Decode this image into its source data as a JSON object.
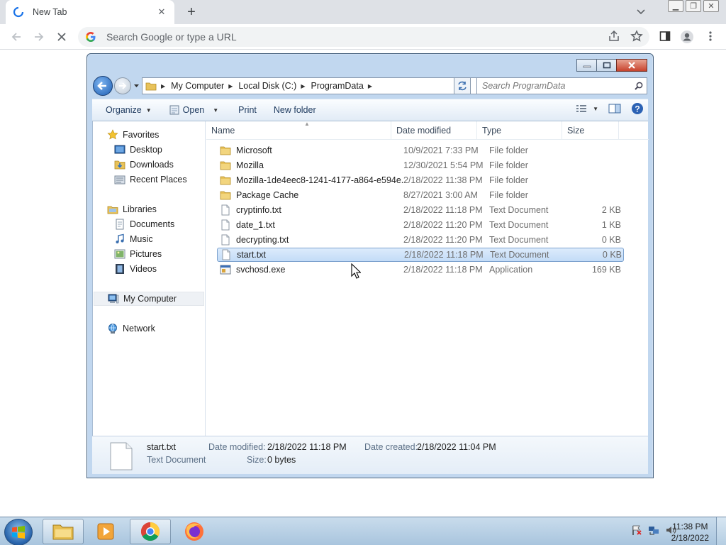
{
  "browser": {
    "tab_title": "New Tab",
    "omnibox_placeholder": "Search Google or type a URL"
  },
  "explorer": {
    "breadcrumb": [
      "My Computer",
      "Local Disk (C:)",
      "ProgramData"
    ],
    "search_placeholder": "Search ProgramData",
    "commands": {
      "organize": "Organize",
      "open": "Open",
      "print": "Print",
      "new_folder": "New folder"
    },
    "nav": {
      "favorites": "Favorites",
      "desktop": "Desktop",
      "downloads": "Downloads",
      "recent_places": "Recent Places",
      "libraries": "Libraries",
      "documents": "Documents",
      "music": "Music",
      "pictures": "Pictures",
      "videos": "Videos",
      "my_computer": "My Computer",
      "network": "Network"
    },
    "columns": {
      "name": "Name",
      "date": "Date modified",
      "type": "Type",
      "size": "Size"
    },
    "files": [
      {
        "name": "Microsoft",
        "date": "10/9/2021 7:33 PM",
        "type": "File folder",
        "size": "",
        "kind": "folder"
      },
      {
        "name": "Mozilla",
        "date": "12/30/2021 5:54 PM",
        "type": "File folder",
        "size": "",
        "kind": "folder"
      },
      {
        "name": "Mozilla-1de4eec8-1241-4177-a864-e594e...",
        "date": "2/18/2022 11:38 PM",
        "type": "File folder",
        "size": "",
        "kind": "folder"
      },
      {
        "name": "Package Cache",
        "date": "8/27/2021 3:00 AM",
        "type": "File folder",
        "size": "",
        "kind": "folder"
      },
      {
        "name": "cryptinfo.txt",
        "date": "2/18/2022 11:18 PM",
        "type": "Text Document",
        "size": "2 KB",
        "kind": "text"
      },
      {
        "name": "date_1.txt",
        "date": "2/18/2022 11:20 PM",
        "type": "Text Document",
        "size": "1 KB",
        "kind": "text"
      },
      {
        "name": "decrypting.txt",
        "date": "2/18/2022 11:20 PM",
        "type": "Text Document",
        "size": "0 KB",
        "kind": "text"
      },
      {
        "name": "start.txt",
        "date": "2/18/2022 11:18 PM",
        "type": "Text Document",
        "size": "0 KB",
        "kind": "text",
        "selected": true
      },
      {
        "name": "svchosd.exe",
        "date": "2/18/2022 11:18 PM",
        "type": "Application",
        "size": "169 KB",
        "kind": "exe"
      }
    ],
    "details": {
      "filename": "start.txt",
      "filetype": "Text Document",
      "modified_label": "Date modified:",
      "modified_value": "2/18/2022 11:18 PM",
      "created_label": "Date created:",
      "created_value": "2/18/2022 11:04 PM",
      "size_label": "Size:",
      "size_value": "0 bytes"
    }
  },
  "taskbar": {
    "time": "11:38 PM",
    "date": "2/18/2022"
  },
  "colors": {
    "selection": "#cce8ff",
    "explorer_frame": "#c1d7ef",
    "taskbar": "#b9d1e6"
  }
}
